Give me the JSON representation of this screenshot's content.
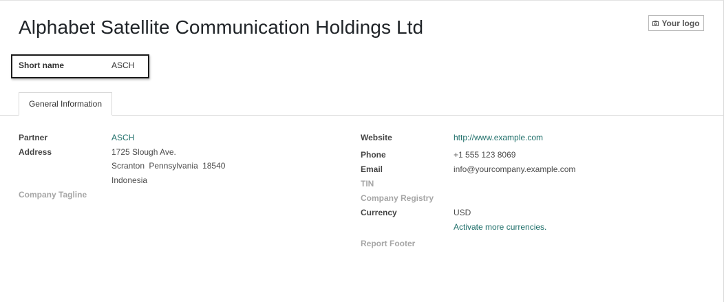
{
  "company": {
    "name": "Alphabet Satellite Communication Holdings Ltd",
    "logo_button": "Your logo",
    "short_name_label": "Short name",
    "short_name_value": "ASCH"
  },
  "tabs": [
    {
      "label": "General Information",
      "active": true
    }
  ],
  "left": {
    "partner_label": "Partner",
    "partner_value": "ASCH",
    "address_label": "Address",
    "address_line1": "1725 Slough Ave.",
    "address_line2": "Scranton  Pennsylvania  18540",
    "address_line3": "Indonesia",
    "tagline_label": "Company Tagline"
  },
  "right": {
    "website_label": "Website",
    "website_value": "http://www.example.com",
    "phone_label": "Phone",
    "phone_value": "+1 555 123 8069",
    "email_label": "Email",
    "email_value": "info@yourcompany.example.com",
    "tin_label": "TIN",
    "registry_label": "Company Registry",
    "currency_label": "Currency",
    "currency_value": "USD",
    "activate_link": "Activate more currencies.",
    "footer_label": "Report Footer"
  },
  "colors": {
    "link": "#1f6f6a",
    "muted_label": "#a6a6a6",
    "highlight_border": "#1a1a1a"
  },
  "icons": {
    "logo_button_icon": "camera-icon"
  }
}
